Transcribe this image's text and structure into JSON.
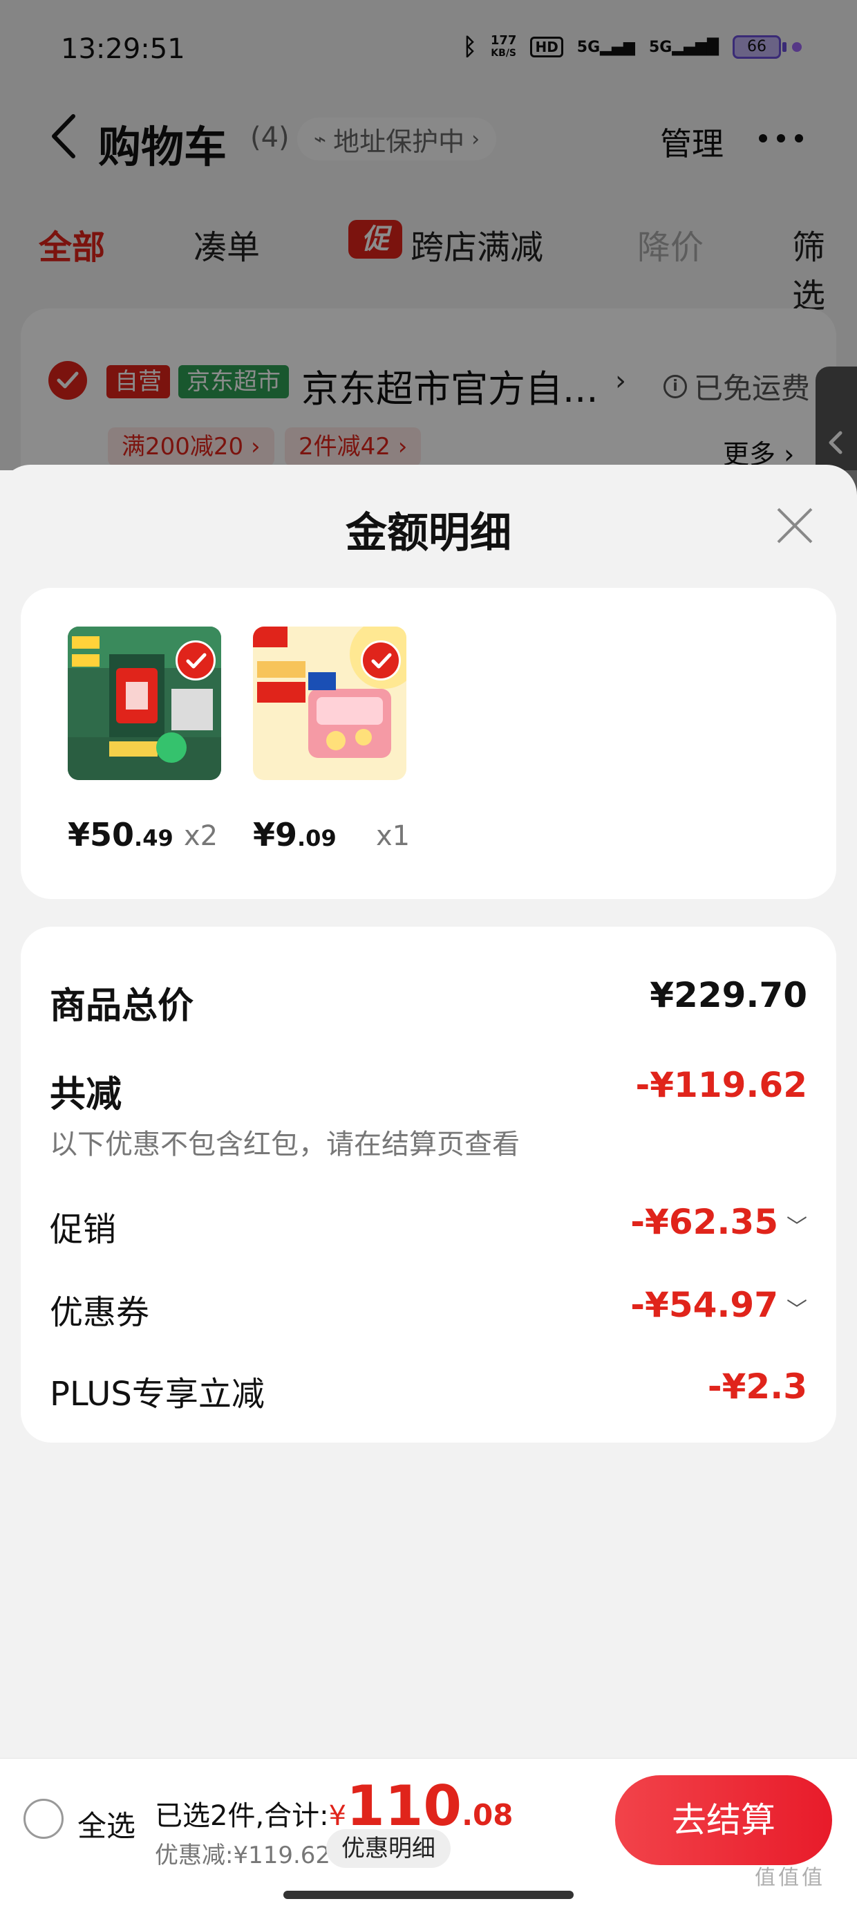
{
  "status_bar": {
    "time": "13:29:51",
    "speed_value": "177",
    "speed_unit": "KB/S",
    "hd": "HD",
    "sig1": "5G",
    "sig2": "5G",
    "battery": "66"
  },
  "nav": {
    "title": "购物车",
    "count": "(4)",
    "address": "地址保护中",
    "manage": "管理"
  },
  "tabs": [
    "全部",
    "凑单",
    "跨店满减",
    "降价",
    "筛选"
  ],
  "promo_badge": "促",
  "store": {
    "self_tag": "自营",
    "channel_tag": "京东超市",
    "name": "京东超市官方自...",
    "shipping": "已免运费",
    "promos": [
      "满200减20 ›",
      "2件减42 ›"
    ],
    "more": "更多 ›"
  },
  "sheet": {
    "title": "金额明细",
    "products": [
      {
        "price_int": "¥50",
        "price_dec": ".49",
        "qty": "x2",
        "image": "tissue-product"
      },
      {
        "price_int": "¥9",
        "price_dec": ".09",
        "qty": "x1",
        "image": "liby-detergent-product"
      }
    ],
    "summary": {
      "total_label": "商品总价",
      "total_value": "¥229.70",
      "reduce_label": "共减",
      "reduce_value": "-¥119.62",
      "note": "以下优惠不包含红包，请在结算页查看",
      "rows": [
        {
          "label": "促销",
          "value": "-¥62.35",
          "expandable": true
        },
        {
          "label": "优惠券",
          "value": "-¥54.97",
          "expandable": true
        },
        {
          "label": "PLUS专享立减",
          "value": "-¥2.3",
          "expandable": false
        }
      ]
    }
  },
  "bottom": {
    "select_all": "全选",
    "selected_text": "已选2件,合计:",
    "currency": "¥",
    "total_int": "110",
    "total_dec": ".08",
    "discount": "优惠减:¥119.62",
    "detail": "优惠明细",
    "checkout": "去结算"
  },
  "watermark": "值值值",
  "colors": {
    "accent": "#e0241b",
    "green_tag": "#2e9e55"
  }
}
